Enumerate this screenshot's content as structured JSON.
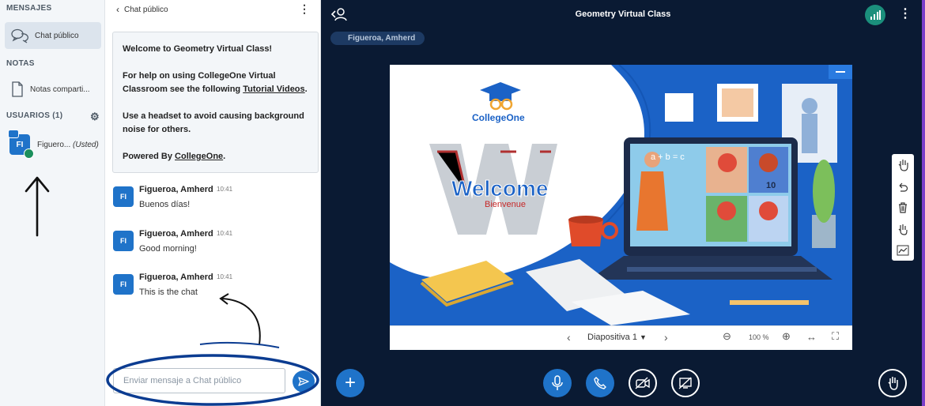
{
  "sidebar": {
    "messages_title": "MENSAJES",
    "public_chat_label": "Chat público",
    "notes_title": "NOTAS",
    "shared_notes_label": "Notas comparti...",
    "users_title": "USUARIOS (1)",
    "user": {
      "initials": "FI",
      "name": "Figuero...",
      "you_label": "(Usted)"
    }
  },
  "chat": {
    "header_title": "Chat público",
    "welcome": {
      "line1": "Welcome to Geometry Virtual Class!",
      "line2_pre": "For help on using CollegeOne Virtual Classroom see the following ",
      "line2_link": "Tutorial Videos",
      "line2_post": ".",
      "line3": "Use a headset to avoid causing background noise for others.",
      "line4_pre": "Powered By ",
      "line4_link": "CollegeOne",
      "line4_post": "."
    },
    "messages": [
      {
        "initials": "FI",
        "sender": "Figueroa, Amherd",
        "time": "10:41",
        "text": "Buenos días!"
      },
      {
        "initials": "FI",
        "sender": "Figueroa, Amherd",
        "time": "10:41",
        "text": "Good morning!"
      },
      {
        "initials": "FI",
        "sender": "Figueroa, Amherd",
        "time": "10:41",
        "text": "This is the chat"
      }
    ],
    "input_placeholder": "Enviar mensaje a Chat público"
  },
  "main": {
    "title": "Geometry Virtual Class",
    "presenter": "Figueroa, Amherd",
    "slide": {
      "logo_text": "CollegeOne",
      "welcome_word": "Welcome",
      "bienvenue_word": "Bienvenue",
      "formula": "a + b = c",
      "number": "10"
    },
    "slide_toolbar": {
      "slide_label": "Diapositiva 1",
      "zoom": "100 %"
    }
  },
  "colors": {
    "accent": "#1f73c9",
    "dark_bg": "#0a1a33",
    "slide_blue": "#1b62c6",
    "annotation": "#0b3c91"
  }
}
